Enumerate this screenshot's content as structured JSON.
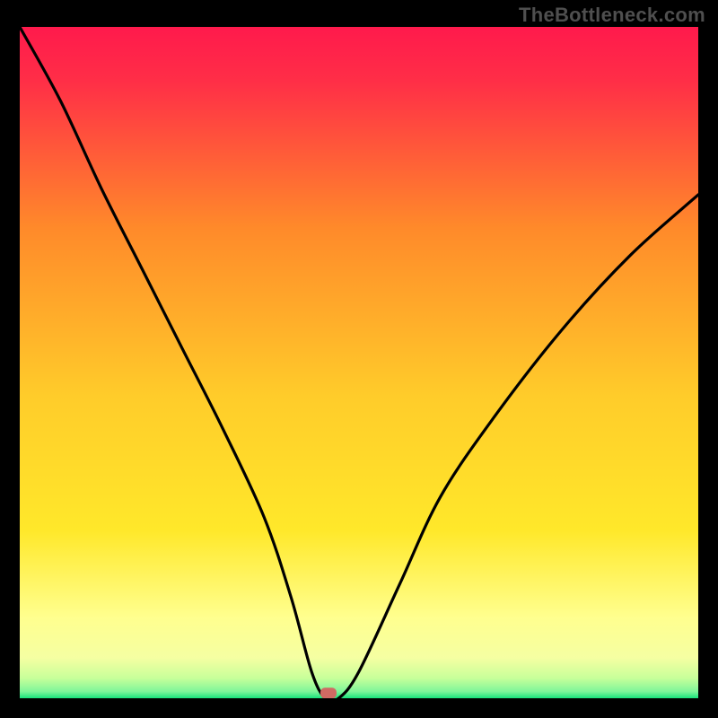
{
  "attribution": "TheBottleneck.com",
  "chart_data": {
    "type": "line",
    "title": "",
    "xlabel": "",
    "ylabel": "",
    "xlim": [
      0,
      100
    ],
    "ylim": [
      0,
      100
    ],
    "grid": false,
    "legend": false,
    "gradient_colors": {
      "top": "#ff1a4c",
      "upper_mid": "#ff8a2a",
      "mid": "#ffe82a",
      "lower_mid": "#ffff8f",
      "bottom": "#18e27c"
    },
    "optimal_x": 45,
    "series": [
      {
        "name": "bottleneck-curve",
        "x": [
          0,
          6,
          12,
          18,
          24,
          30,
          36,
          40,
          43,
          45,
          47,
          50,
          56,
          62,
          70,
          80,
          90,
          100
        ],
        "y": [
          100,
          89,
          76,
          64,
          52,
          40,
          27,
          15,
          4,
          0,
          0,
          4,
          17,
          30,
          42,
          55,
          66,
          75
        ]
      }
    ],
    "marker": {
      "x": 45.5,
      "y": 0.5,
      "color": "#d06a63"
    }
  }
}
